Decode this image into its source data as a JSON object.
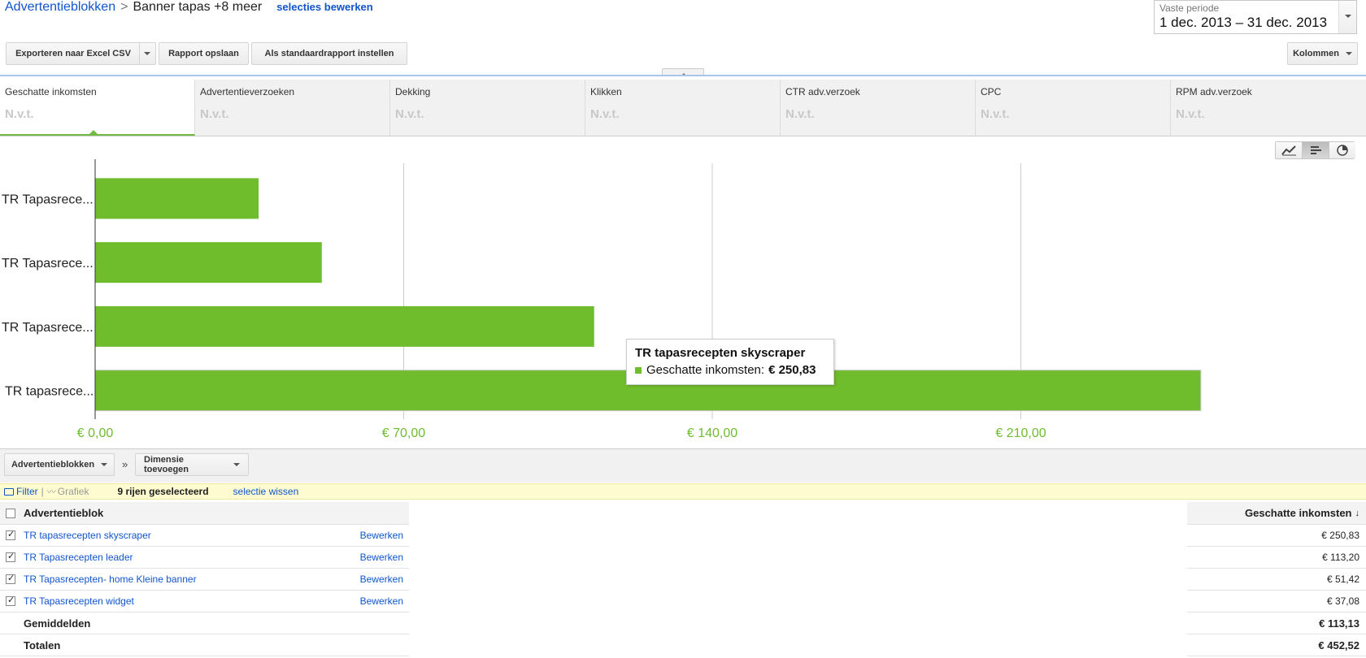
{
  "header": {
    "breadcrumb_link": "Advertentieblokken",
    "separator": ">",
    "current": "Banner tapas +8 meer",
    "edit_selection": "selecties bewerken"
  },
  "period": {
    "label": "Vaste periode",
    "value": "1 dec. 2013 – 31 dec. 2013"
  },
  "toolbar": {
    "export_label": "Exporteren naar Excel CSV",
    "save_label": "Rapport opslaan",
    "default_label": "Als standaardrapport instellen",
    "columns_label": "Kolommen"
  },
  "metrics": [
    {
      "name": "Geschatte inkomsten",
      "value": "N.v.t."
    },
    {
      "name": "Advertentieverzoeken",
      "value": "N.v.t."
    },
    {
      "name": "Dekking",
      "value": "N.v.t."
    },
    {
      "name": "Klikken",
      "value": "N.v.t."
    },
    {
      "name": "CTR adv.verzoek",
      "value": "N.v.t."
    },
    {
      "name": "CPC",
      "value": "N.v.t."
    },
    {
      "name": "RPM adv.verzoek",
      "value": "N.v.t."
    }
  ],
  "chart_data": {
    "type": "bar",
    "orientation": "horizontal",
    "categories": [
      "TR Tapasrecepten widget",
      "TR Tapasrecepten- home Kleine banner",
      "TR Tapasrecepten leader",
      "TR tapasrecepten skyscraper"
    ],
    "category_labels": [
      "TR Tapasrece...",
      "TR Tapasrece...",
      "TR Tapasrece...",
      "TR tapasrece..."
    ],
    "values": [
      37.08,
      51.42,
      113.2,
      250.83
    ],
    "xlim": [
      0,
      280
    ],
    "ticks": [
      0,
      70,
      140,
      210
    ],
    "tick_labels": [
      "€ 0,00",
      "€ 70,00",
      "€ 140,00",
      "€ 210,00"
    ],
    "grid": true,
    "color": "#6fbc2c",
    "highlighted": 3
  },
  "tooltip": {
    "title": "TR tapasrecepten skyscraper",
    "metric": "Geschatte inkomsten:",
    "amount": "€ 250,83"
  },
  "dimension": {
    "primary": "Advertentieblokken",
    "separator": "»",
    "add": "Dimensie toevoegen"
  },
  "filterbar": {
    "filter": "Filter",
    "chart": "Grafiek",
    "selected": "9 rijen geselecteerd",
    "clear": "selectie wissen"
  },
  "table": {
    "col_name": "Advertentieblok",
    "col_value": "Geschatte inkomsten",
    "edit_label": "Bewerken",
    "rows": [
      {
        "name": "TR tapasrecepten skyscraper",
        "value": "€ 250,83"
      },
      {
        "name": "TR Tapasrecepten leader",
        "value": "€ 113,20"
      },
      {
        "name": "TR Tapasrecepten- home Kleine banner",
        "value": "€ 51,42"
      },
      {
        "name": "TR Tapasrecepten widget",
        "value": "€ 37,08"
      }
    ],
    "avg_label": "Gemiddelden",
    "avg_value": "€ 113,13",
    "total_label": "Totalen",
    "total_value": "€ 452,52"
  }
}
